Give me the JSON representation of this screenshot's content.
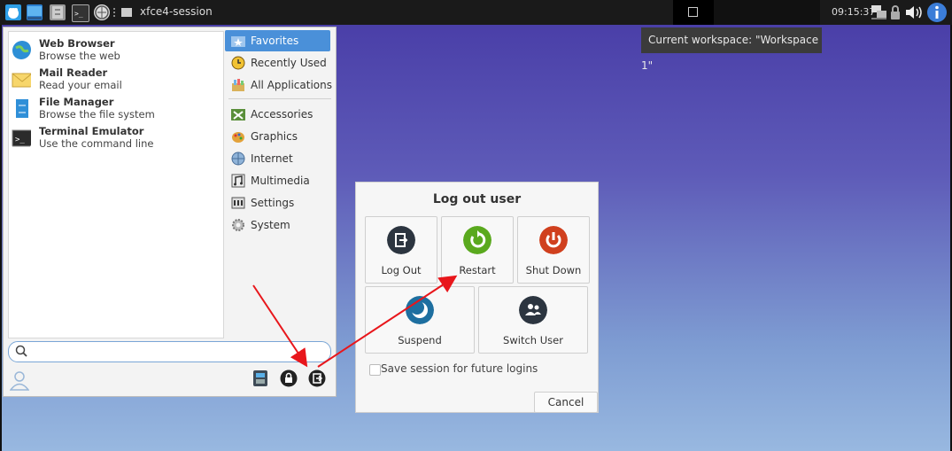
{
  "panel": {
    "window_title": "xfce4-session",
    "clock": "09:15:37"
  },
  "tooltip": {
    "text": "Current workspace: \"Workspace 1\""
  },
  "menu": {
    "favorites": [
      {
        "title": "Web Browser",
        "subtitle": "Browse the web",
        "icon": "globe-icon"
      },
      {
        "title": "Mail Reader",
        "subtitle": "Read your email",
        "icon": "envelope-icon"
      },
      {
        "title": "File Manager",
        "subtitle": "Browse the file system",
        "icon": "file-cabinet-icon"
      },
      {
        "title": "Terminal Emulator",
        "subtitle": "Use the command line",
        "icon": "terminal-icon"
      }
    ],
    "categories": [
      {
        "label": "Favorites",
        "selected": true
      },
      {
        "label": "Recently Used"
      },
      {
        "label": "All Applications"
      },
      {
        "label": "Accessories"
      },
      {
        "label": "Graphics"
      },
      {
        "label": "Internet"
      },
      {
        "label": "Multimedia"
      },
      {
        "label": "Settings"
      },
      {
        "label": "System"
      }
    ],
    "search_placeholder": ""
  },
  "dialog": {
    "title": "Log out user",
    "actions": {
      "logout": "Log Out",
      "restart": "Restart",
      "shutdown": "Shut Down",
      "suspend": "Suspend",
      "switch_user": "Switch User"
    },
    "save_session_label": "Save session for future logins",
    "save_session_checked": false,
    "cancel_label": "Cancel"
  },
  "colors": {
    "selected_category": "#4a90d9",
    "restart_green": "#5aa91e",
    "shutdown_red": "#d0401e",
    "suspend_blue": "#1e6fa0",
    "dark_icon": "#2c3540",
    "annotation_arrow": "#e8161b"
  }
}
